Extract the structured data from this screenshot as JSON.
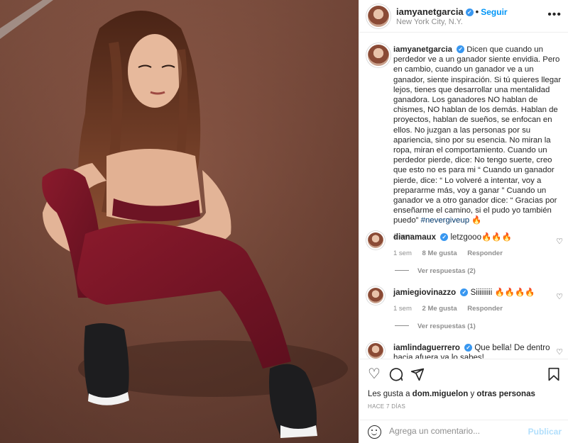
{
  "post": {
    "username": "iamyanetgarcia",
    "location": "New York City, N.Y.",
    "follow_label": "Seguir",
    "caption": {
      "username": "iamyanetgarcia",
      "text": "Dicen que cuando un perdedor ve a un ganador siente envidia. Pero en cambio, cuando un ganador ve a un ganador, siente inspiración. Si tú quieres llegar lejos, tienes que desarrollar una mentalidad ganadora. Los ganadores NO hablan de chismes, NO hablan de los demás. Hablan de proyectos, hablan de sueños, se enfocan en ellos. No juzgan a las personas por su apariencia, sino por su esencia. No miran la ropa, miran el comportamiento. Cuando un perdedor pierde, dice: No tengo suerte, creo que esto no es para mi “ Cuando un ganador pierde, dice: “ Lo volveré a intentar, voy a prepararme más, voy a ganar ” Cuando un ganador ve a otro ganador dice: “ Gracias por enseñarme el camino, si el pudo yo también puedo”",
      "hashtag": "#nevergiveup",
      "emoji": "🔥",
      "time": "1 sem"
    },
    "comments": [
      {
        "username": "dianamaux",
        "text": "letzgooo🔥🔥🔥",
        "time": "1 sem",
        "likes": "8 Me gusta",
        "reply_label": "Responder",
        "replies": "Ver respuestas (2)"
      },
      {
        "username": "jamiegiovinazzo",
        "text": "Siiiiiiiii 🔥🔥🔥🔥",
        "time": "1 sem",
        "likes": "2 Me gusta",
        "reply_label": "Responder",
        "replies": "Ver respuestas (1)"
      },
      {
        "username": "iamlindaguerrero",
        "text": "Que bella! De dentro hacia afuera ya lo sabes!"
      }
    ],
    "liked_by_prefix": "Les gusta a",
    "liked_by_user": "dom.miguelon",
    "liked_by_joiner": "y",
    "liked_by_suffix": "otras personas",
    "posted_ago": "HACE 7 DÍAS",
    "comment_placeholder": "Agrega un comentario...",
    "publish_label": "Publicar"
  },
  "icons": {
    "heart": "heart-icon",
    "comment": "comment-icon",
    "share": "paper-plane-icon",
    "save": "bookmark-icon",
    "emoji": "smile-icon",
    "more": "more-options-icon",
    "verified": "verified-badge-icon"
  },
  "colors": {
    "link": "#0095f6",
    "hashtag": "#00376b",
    "muted": "#8e8e8e",
    "verified": "#3897f0"
  }
}
